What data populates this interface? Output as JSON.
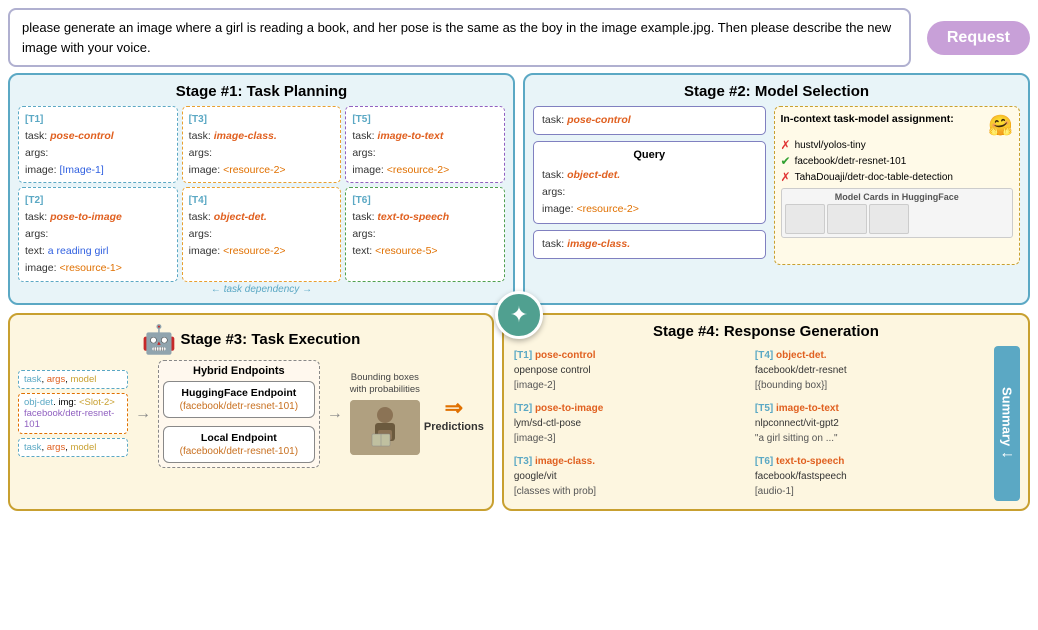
{
  "request": {
    "text": "please generate an image where a girl is reading a book, and her pose is the same as the boy in the image example.jpg. Then please describe the new image with your voice.",
    "badge": "Request"
  },
  "stage1": {
    "title": "Stage #1: Task Planning",
    "tasks": [
      {
        "id": "[T1]",
        "task_label": "task:",
        "task_val": "pose-control",
        "args_label": "args:",
        "img_label": "image:",
        "img_val": "[Image-1]",
        "border": "blue"
      },
      {
        "id": "[T3]",
        "task_label": "task:",
        "task_val": "image-class.",
        "args_label": "args:",
        "img_label": "image:",
        "img_val": "<resource-2>",
        "border": "orange"
      },
      {
        "id": "[T5]",
        "task_label": "task:",
        "task_val": "image-to-text",
        "args_label": "args:",
        "img_label": "image:",
        "img_val": "<resource-2>",
        "border": "purple"
      },
      {
        "id": "[T2]",
        "task_label": "task:",
        "task_val": "pose-to-image",
        "args_label": "args:",
        "text_label": "text:",
        "text_val": "a reading girl",
        "img_label": "image:",
        "img_val": "<resource-1>",
        "border": "blue"
      },
      {
        "id": "[T4]",
        "task_label": "task:",
        "task_val": "object-det.",
        "args_label": "args:",
        "img_label": "image:",
        "img_val": "<resource-2>",
        "border": "orange"
      },
      {
        "id": "[T6]",
        "task_label": "task:",
        "task_val": "text-to-speech",
        "args_label": "args:",
        "text_label": "text:",
        "text_val": "<resource-5>",
        "border": "green"
      }
    ],
    "dep_label": "task dependency"
  },
  "stage2": {
    "title": "Stage #2: Model Selection",
    "query": {
      "title": "Query",
      "task_label": "task:",
      "task_val": "object-det.",
      "args_label": "args:",
      "img_label": "image:",
      "img_val": "<resource-2>",
      "task2_label": "task:",
      "task2_val": "image-class."
    },
    "model_selection": {
      "title": "In-context task-model assignment:",
      "emoji": "🤗",
      "models": [
        {
          "icon": "x",
          "name": "hustvl/yolos-tiny"
        },
        {
          "icon": "check",
          "name": "facebook/detr-resnet-101"
        },
        {
          "icon": "x",
          "name": "TahaDouaji/detr-doc-table-detection"
        }
      ],
      "cards_label": "Model Cards in HuggingFace"
    },
    "query_task": {
      "label": "task:",
      "val": "pose-control"
    }
  },
  "stage3": {
    "title": "Stage #3: Task Execution",
    "emoji": "🤖",
    "left_cards": [
      {
        "lines": [
          "task, args, model"
        ],
        "border": "blue"
      },
      {
        "lines": [
          "obj-det. img: <Slot-2>",
          "facebook/detr-resnet-101"
        ],
        "border": "orange"
      },
      {
        "lines": [
          "task, args, model"
        ],
        "border": "blue"
      }
    ],
    "hybrid_label": "Hybrid Endpoints",
    "endpoints": [
      {
        "title": "HuggingFace Endpoint",
        "sub": "(facebook/detr-resnet-101)"
      },
      {
        "title": "Local Endpoint",
        "sub": "(facebook/detr-resnet-101)"
      }
    ],
    "bb_label": "Bounding boxes\nwith probabilities",
    "predictions_label": "Predictions"
  },
  "stage4": {
    "title": "Stage #4: Response Generation",
    "items": [
      {
        "tid": "[T1]",
        "task": "pose-control",
        "model": "openpose control",
        "resource": "[image-2]"
      },
      {
        "tid": "[T4]",
        "task": "object-det.",
        "model": "facebook/detr-resnet",
        "resource": "[{bounding box}]"
      },
      {
        "tid": "[T2]",
        "task": "pose-to-image",
        "model": "lym/sd-ctl-pose",
        "resource": "[image-3]"
      },
      {
        "tid": "[T5]",
        "task": "image-to-text",
        "model": "nlpconnect/vit-gpt2",
        "resource": "\"a girl sitting on ...\""
      },
      {
        "tid": "[T3]",
        "task": "image-class.",
        "model": "google/vit",
        "resource": "[classes with prob]"
      },
      {
        "tid": "[T6]",
        "task": "text-to-speech",
        "model": "facebook/fastspeech",
        "resource": "[audio-1]"
      }
    ],
    "summary_label": "Summary"
  }
}
